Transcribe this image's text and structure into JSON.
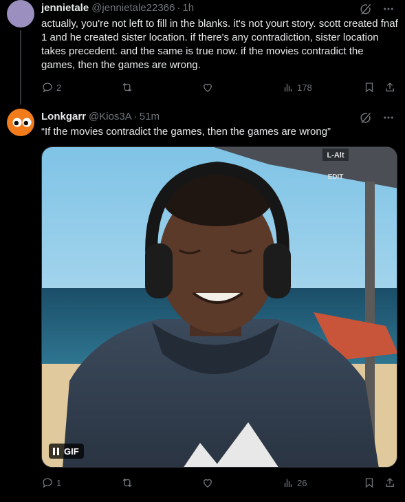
{
  "tweets": [
    {
      "name": "jennietale",
      "handle": "@jennietale22366",
      "time": "1h",
      "text": "actually, you're not left to fill in the blanks. it's not yourt story. scott created fnaf 1 and he created sister location. if there's any contradiction, sister location takes precedent. and the same is true now. if the movies contradict the games, then the games are wrong.",
      "replies": "2",
      "reposts": "",
      "likes": "",
      "views": "178"
    },
    {
      "name": "Lonkgarr",
      "handle": "@Kios3A",
      "time": "51m",
      "text": "“If the movies contradict the games, then the games are wrong”",
      "media": {
        "badge": "GIF",
        "watermark_top": "L-Alt",
        "watermark_bottom": "EDIT"
      },
      "replies": "1",
      "reposts": "",
      "likes": "",
      "views": "26"
    }
  ],
  "colors": {
    "background": "#000000",
    "text": "#e7e9ea",
    "muted": "#71767b",
    "avatar_1": "#9b8fbf",
    "avatar_2": "#f27c1b"
  }
}
